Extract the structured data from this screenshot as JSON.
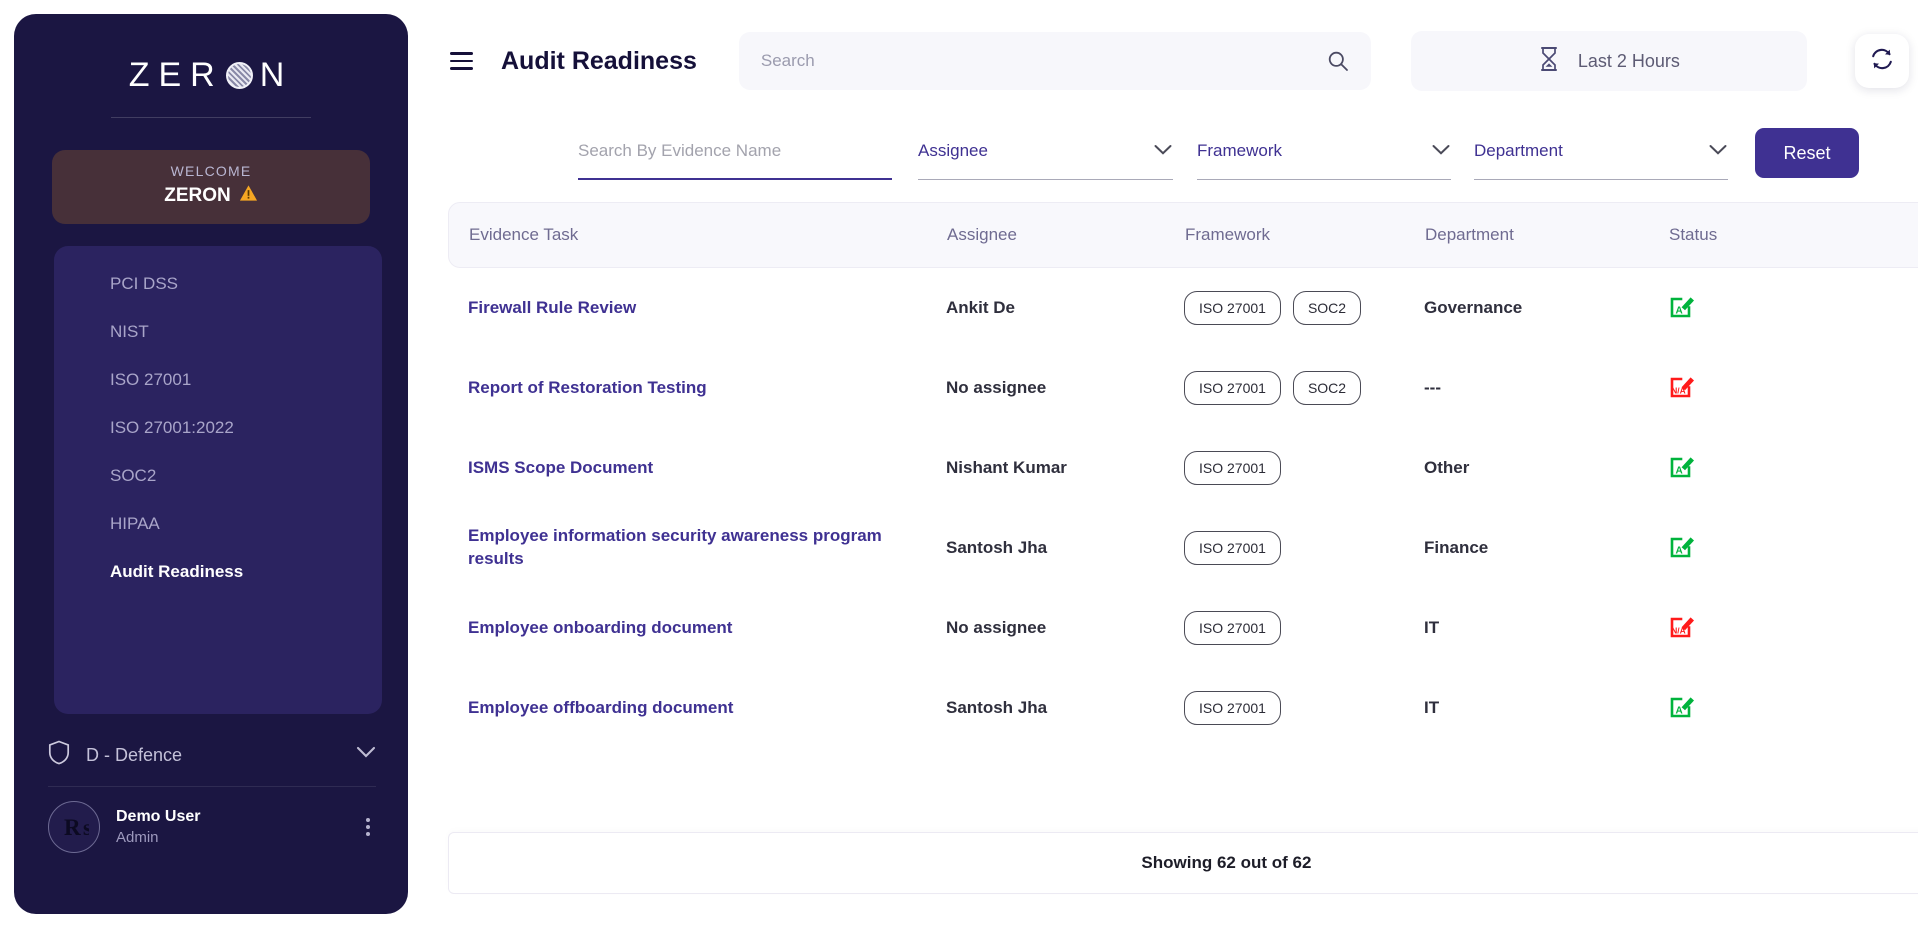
{
  "sidebar": {
    "logo_text_left": "ZE",
    "logo_text_mid": "R",
    "logo_text_right": "N",
    "logo_o_icon": "textured-sphere-icon",
    "welcome_label": "WELCOME",
    "welcome_org": "ZERON",
    "welcome_warning_icon": "warning-triangle-icon",
    "nav_items": [
      {
        "label": "PCI DSS",
        "active": false
      },
      {
        "label": "NIST",
        "active": false
      },
      {
        "label": "ISO 27001",
        "active": false
      },
      {
        "label": "ISO 27001:2022",
        "active": false
      },
      {
        "label": "SOC2",
        "active": false
      },
      {
        "label": "HIPAA",
        "active": false
      },
      {
        "label": "Audit Readiness",
        "active": true
      }
    ],
    "org": {
      "name": "D - Defence",
      "icon": "shield-icon",
      "chevron": "chevron-down-icon"
    },
    "profile": {
      "avatar_letter": "R",
      "name": "Demo User",
      "role": "Admin",
      "menu_icon": "kebab-menu-icon"
    }
  },
  "header": {
    "menu_icon": "hamburger-menu-icon",
    "title": "Audit Readiness",
    "search_placeholder": "Search",
    "search_value": "",
    "search_icon": "search-icon",
    "time_range": {
      "label": "Last 2 Hours",
      "icon": "hourglass-icon"
    },
    "refresh_icon": "refresh-icon",
    "notification_icon": "bell-icon"
  },
  "filters": {
    "evidence_search": {
      "placeholder": "Search By Evidence Name",
      "value": ""
    },
    "assignee": {
      "label": "Assignee",
      "chevron": "chevron-down-icon"
    },
    "framework": {
      "label": "Framework",
      "chevron": "chevron-down-icon"
    },
    "department": {
      "label": "Department",
      "chevron": "chevron-down-icon"
    },
    "reset_label": "Reset"
  },
  "table": {
    "columns": [
      "Evidence Task",
      "Assignee",
      "Framework",
      "Department",
      "Status"
    ],
    "rows": [
      {
        "task": "Firewall Rule Review",
        "assignee": "Ankit De",
        "frameworks": [
          "ISO 27001",
          "SOC2"
        ],
        "department": "Governance",
        "status": "A",
        "status_icon": "edit-approved-icon"
      },
      {
        "task": "Report of Restoration Testing",
        "assignee": "No assignee",
        "frameworks": [
          "ISO 27001",
          "SOC2"
        ],
        "department": "---",
        "status": "N/A",
        "status_icon": "edit-not-applicable-icon"
      },
      {
        "task": "ISMS Scope Document",
        "assignee": "Nishant Kumar",
        "frameworks": [
          "ISO 27001"
        ],
        "department": "Other",
        "status": "A",
        "status_icon": "edit-approved-icon"
      },
      {
        "task": "Employee information security awareness program results",
        "assignee": "Santosh Jha",
        "frameworks": [
          "ISO 27001"
        ],
        "department": "Finance",
        "status": "A",
        "status_icon": "edit-approved-icon"
      },
      {
        "task": "Employee onboarding document",
        "assignee": "No assignee",
        "frameworks": [
          "ISO 27001"
        ],
        "department": "IT",
        "status": "N/A",
        "status_icon": "edit-not-applicable-icon"
      },
      {
        "task": "Employee offboarding document",
        "assignee": "Santosh Jha",
        "frameworks": [
          "ISO 27001"
        ],
        "department": "IT",
        "status": "A",
        "status_icon": "edit-approved-icon"
      }
    ],
    "footer": "Showing 62 out of 62"
  },
  "colors": {
    "sidebar_bg": "#1b1642",
    "nav_panel_bg": "#2b2360",
    "welcome_card_bg": "#473039",
    "accent": "#3f3192",
    "status_approved": "#00b33c",
    "status_na": "#ff1a1a",
    "warning": "#f5a623"
  }
}
